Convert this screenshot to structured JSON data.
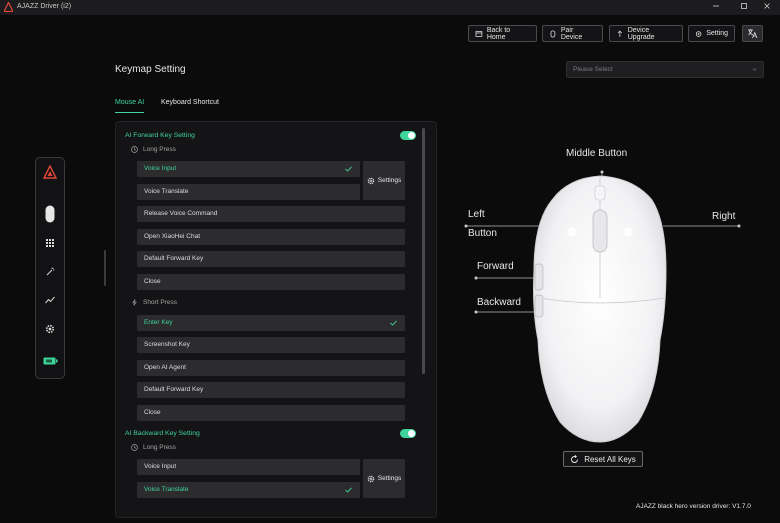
{
  "window": {
    "title": "AJAZZ Driver (i2)"
  },
  "toolbar": {
    "back_home": "Back to Home",
    "pair_device": "Pair Device",
    "device_upgrade": "Device Upgrade",
    "setting": "Setting"
  },
  "page": {
    "title": "Keymap Setting"
  },
  "select": {
    "placeholder": "Please Select"
  },
  "tabs": [
    {
      "label": "Mouse AI"
    },
    {
      "label": "Keyboard Shortcut"
    }
  ],
  "forward": {
    "title": "AI Forward Key Setting",
    "long_press": "Long Press",
    "long_items": [
      "Voice Input",
      "Voice Translate",
      "Release Voice Command",
      "Open XiaoHei Chat",
      "Default Forward Key",
      "Close"
    ],
    "settings": "Settings",
    "short_press": "Short Press",
    "short_items": [
      "Enter Key",
      "Screenshot Key",
      "Open AI Agent",
      "Default Forward Key",
      "Close"
    ]
  },
  "backward": {
    "title": "AI Backward Key Setting",
    "long_press": "Long Press",
    "long_items": [
      "Voice Input",
      "Voice Translate"
    ],
    "settings": "Settings"
  },
  "mouse": {
    "middle": "Middle Button",
    "left_line1": "Left",
    "left_line2": "Button",
    "right": "Right",
    "forward": "Forward",
    "backward": "Backward",
    "reset": "Reset All Keys"
  },
  "footer": {
    "version": "AJAZZ black hero version driver: V1.7.0"
  },
  "colors": {
    "accent": "#3fd49a",
    "background": "#0b0b0c",
    "panel": "#141416",
    "row": "#2c2c2f",
    "logo_red": "#e0463a"
  }
}
